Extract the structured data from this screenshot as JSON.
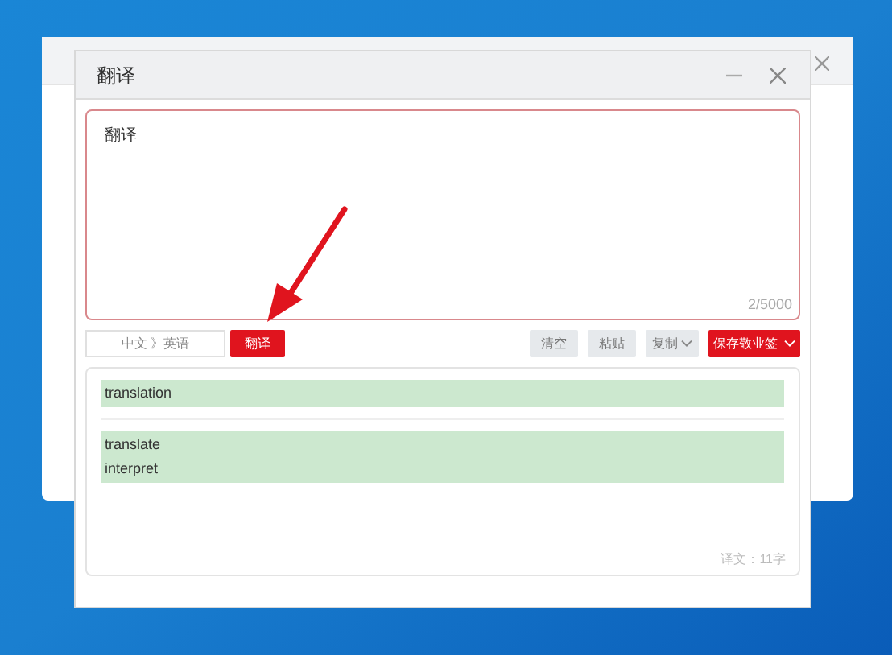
{
  "dialog": {
    "title": "翻译",
    "source": {
      "value": "翻译",
      "counter": "2/5000"
    },
    "language": "中文 》英语",
    "translate_button": "翻译",
    "actions": [
      {
        "label": "清空",
        "kind": "plain"
      },
      {
        "label": "粘贴",
        "kind": "plain"
      },
      {
        "label": "复制",
        "kind": "dropdown"
      },
      {
        "label": "保存敬业签",
        "kind": "primary"
      }
    ],
    "results": [
      {
        "lines": [
          "translation"
        ]
      },
      {
        "lines": [
          "translate",
          "interpret"
        ]
      }
    ],
    "footer": "译文：11字"
  }
}
